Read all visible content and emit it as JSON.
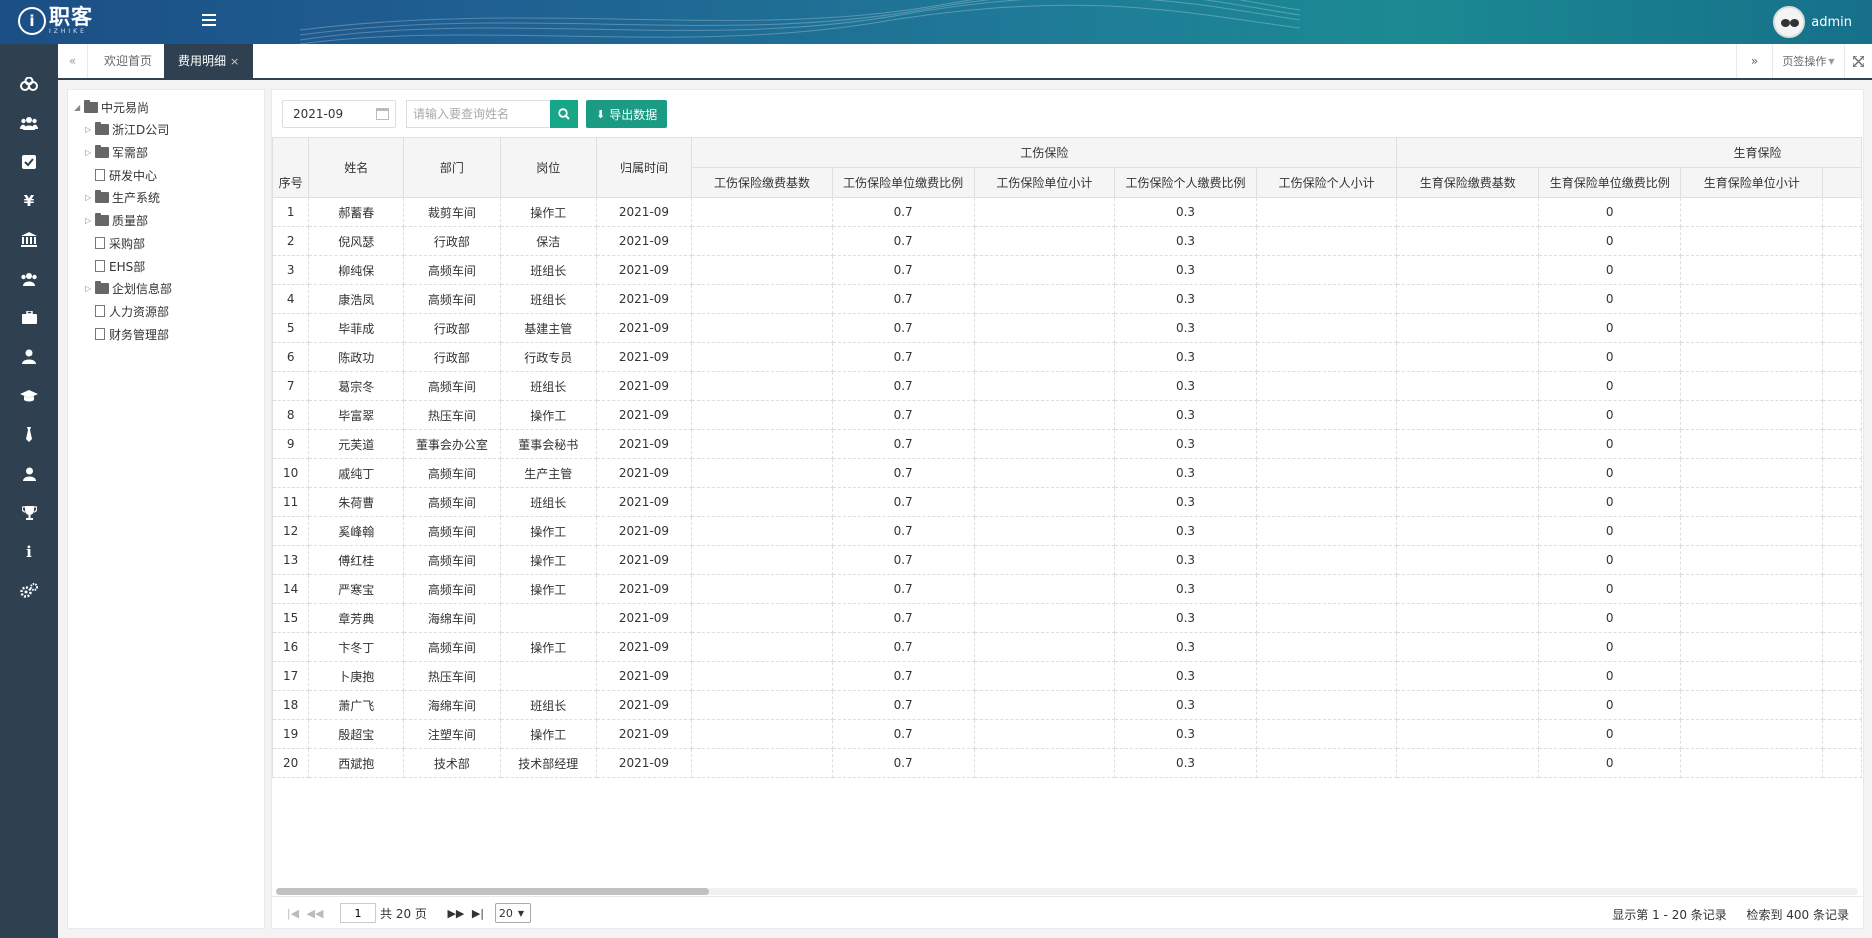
{
  "app": {
    "logo_text": "职客",
    "logo_sub": "IZHIKE",
    "user_name": "admin"
  },
  "tabs": {
    "home": "欢迎首页",
    "active": "费用明细",
    "close": "×",
    "page_ops": "页签操作"
  },
  "leftnav": [
    "dashboard-icon",
    "users-icon",
    "check-icon",
    "yen-icon",
    "bank-icon",
    "group-icon",
    "briefcase-icon",
    "user-tie-icon",
    "graduation-cap-icon",
    "tie-icon",
    "person-icon",
    "trophy-icon",
    "info-icon",
    "cogs-icon"
  ],
  "tree": {
    "root": "中元易尚",
    "children": [
      {
        "label": "浙江D公司",
        "type": "folder"
      },
      {
        "label": "军需部",
        "type": "folder"
      },
      {
        "label": "研发中心",
        "type": "file"
      },
      {
        "label": "生产系统",
        "type": "folder"
      },
      {
        "label": "质量部",
        "type": "folder"
      },
      {
        "label": "采购部",
        "type": "file"
      },
      {
        "label": "EHS部",
        "type": "file"
      },
      {
        "label": "企划信息部",
        "type": "folder"
      },
      {
        "label": "人力资源部",
        "type": "file"
      },
      {
        "label": "财务管理部",
        "type": "file"
      }
    ]
  },
  "toolbar": {
    "date": "2021-09",
    "search_placeholder": "请输入要查询姓名",
    "export_label": "导出数据"
  },
  "table": {
    "head_index": "序号",
    "head_fixed": [
      "姓名",
      "部门",
      "岗位",
      "归属时间"
    ],
    "group_injury": "工伤保险",
    "group_maternity": "生育保险",
    "injury_cols": [
      "工伤保险缴费基数",
      "工伤保险单位缴费比例",
      "工伤保险单位小计",
      "工伤保险个人缴费比例",
      "工伤保险个人小计"
    ],
    "maternity_cols": [
      "生育保险缴费基数",
      "生育保险单位缴费比例",
      "生育保险单位小计"
    ],
    "rows": [
      [
        "1",
        "郝蓄春",
        "裁剪车间",
        "操作工",
        "2021-09",
        "",
        "0.7",
        "",
        "0.3",
        "",
        "",
        "0",
        ""
      ],
      [
        "2",
        "倪风瑟",
        "行政部",
        "保洁",
        "2021-09",
        "",
        "0.7",
        "",
        "0.3",
        "",
        "",
        "0",
        ""
      ],
      [
        "3",
        "柳纯保",
        "高频车间",
        "班组长",
        "2021-09",
        "",
        "0.7",
        "",
        "0.3",
        "",
        "",
        "0",
        ""
      ],
      [
        "4",
        "康浩凤",
        "高频车间",
        "班组长",
        "2021-09",
        "",
        "0.7",
        "",
        "0.3",
        "",
        "",
        "0",
        ""
      ],
      [
        "5",
        "毕菲成",
        "行政部",
        "基建主管",
        "2021-09",
        "",
        "0.7",
        "",
        "0.3",
        "",
        "",
        "0",
        ""
      ],
      [
        "6",
        "陈政功",
        "行政部",
        "行政专员",
        "2021-09",
        "",
        "0.7",
        "",
        "0.3",
        "",
        "",
        "0",
        ""
      ],
      [
        "7",
        "葛宗冬",
        "高频车间",
        "班组长",
        "2021-09",
        "",
        "0.7",
        "",
        "0.3",
        "",
        "",
        "0",
        ""
      ],
      [
        "8",
        "毕富翠",
        "热压车间",
        "操作工",
        "2021-09",
        "",
        "0.7",
        "",
        "0.3",
        "",
        "",
        "0",
        ""
      ],
      [
        "9",
        "元芙道",
        "董事会办公室",
        "董事会秘书",
        "2021-09",
        "",
        "0.7",
        "",
        "0.3",
        "",
        "",
        "0",
        ""
      ],
      [
        "10",
        "戚纯丁",
        "高频车间",
        "生产主管",
        "2021-09",
        "",
        "0.7",
        "",
        "0.3",
        "",
        "",
        "0",
        ""
      ],
      [
        "11",
        "朱荷曹",
        "高频车间",
        "班组长",
        "2021-09",
        "",
        "0.7",
        "",
        "0.3",
        "",
        "",
        "0",
        ""
      ],
      [
        "12",
        "奚峰翰",
        "高频车间",
        "操作工",
        "2021-09",
        "",
        "0.7",
        "",
        "0.3",
        "",
        "",
        "0",
        ""
      ],
      [
        "13",
        "傅红桂",
        "高频车间",
        "操作工",
        "2021-09",
        "",
        "0.7",
        "",
        "0.3",
        "",
        "",
        "0",
        ""
      ],
      [
        "14",
        "严寒宝",
        "高频车间",
        "操作工",
        "2021-09",
        "",
        "0.7",
        "",
        "0.3",
        "",
        "",
        "0",
        ""
      ],
      [
        "15",
        "章芳典",
        "海绵车间",
        "",
        "2021-09",
        "",
        "0.7",
        "",
        "0.3",
        "",
        "",
        "0",
        ""
      ],
      [
        "16",
        "卞冬丁",
        "高频车间",
        "操作工",
        "2021-09",
        "",
        "0.7",
        "",
        "0.3",
        "",
        "",
        "0",
        ""
      ],
      [
        "17",
        "卜庚抱",
        "热压车间",
        "",
        "2021-09",
        "",
        "0.7",
        "",
        "0.3",
        "",
        "",
        "0",
        ""
      ],
      [
        "18",
        "萧广飞",
        "海绵车间",
        "班组长",
        "2021-09",
        "",
        "0.7",
        "",
        "0.3",
        "",
        "",
        "0",
        ""
      ],
      [
        "19",
        "殷超宝",
        "注塑车间",
        "操作工",
        "2021-09",
        "",
        "0.7",
        "",
        "0.3",
        "",
        "",
        "0",
        ""
      ],
      [
        "20",
        "西斌抱",
        "技术部",
        "技术部经理",
        "2021-09",
        "",
        "0.7",
        "",
        "0.3",
        "",
        "",
        "0",
        ""
      ]
    ]
  },
  "pager": {
    "page": "1",
    "total_pages": "共 20 页",
    "page_size": "20",
    "info_range": "显示第 1 - 20 条记录",
    "info_total": "检索到 400 条记录"
  }
}
